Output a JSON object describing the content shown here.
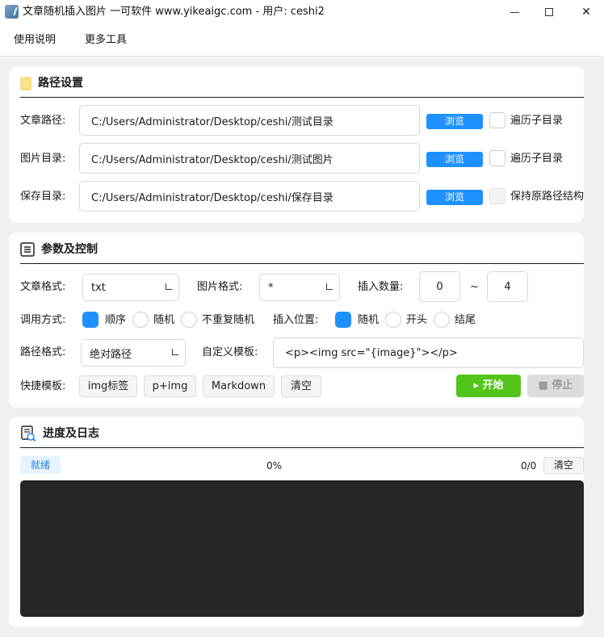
{
  "window": {
    "title": "文章随机插入图片  一可软件 www.yikeaigc.com - 用户: ceshi2"
  },
  "menu": {
    "items": [
      "使用说明",
      "更多工具"
    ]
  },
  "path_section": {
    "title": "路径设置",
    "icon": "folder-icon",
    "rows": [
      {
        "label": "文章路径:",
        "value": "C:/Users/Administrator/Desktop/ceshi/测试目录",
        "browse": "浏览",
        "check_label": "遍历子目录",
        "checked": false,
        "disabled": false
      },
      {
        "label": "图片目录:",
        "value": "C:/Users/Administrator/Desktop/ceshi/测试图片",
        "browse": "浏览",
        "check_label": "遍历子目录",
        "checked": false,
        "disabled": false
      },
      {
        "label": "保存目录:",
        "value": "C:/Users/Administrator/Desktop/ceshi/保存目录",
        "browse": "浏览",
        "check_label": "保持原路径结构",
        "checked": false,
        "disabled": true
      }
    ]
  },
  "params_section": {
    "title": "参数及控制",
    "icon": "list-icon",
    "article_format": {
      "label": "文章格式:",
      "value": "txt"
    },
    "image_format": {
      "label": "图片格式:",
      "value": "*"
    },
    "insert_count": {
      "label": "插入数量:",
      "min": "0",
      "sep": "~",
      "max": "4"
    },
    "call_mode": {
      "label": "调用方式:",
      "options": [
        "顺序",
        "随机",
        "不重复随机"
      ],
      "selected": "顺序"
    },
    "insert_position": {
      "label": "插入位置:",
      "options": [
        "随机",
        "开头",
        "结尾"
      ],
      "selected": "随机"
    },
    "path_format": {
      "label": "路径格式:",
      "value": "绝对路径"
    },
    "custom_template": {
      "label": "自定义模板:",
      "value": "<p><img src=\"{image}\"></p>"
    },
    "quick_template": {
      "label": "快捷模板:",
      "buttons": [
        "img标签",
        "p+img",
        "Markdown",
        "清空"
      ]
    },
    "start_label": "▸ 开始",
    "stop_label": "■ 停止"
  },
  "progress_section": {
    "title": "进度及日志",
    "icon": "log-icon",
    "status": "就绪",
    "percent": "0%",
    "count": "0/0",
    "clear_label": "清空",
    "log_text": ""
  },
  "colors": {
    "accent_blue": "#1e90ff",
    "start_green": "#52c41a",
    "log_background": "#262626"
  }
}
